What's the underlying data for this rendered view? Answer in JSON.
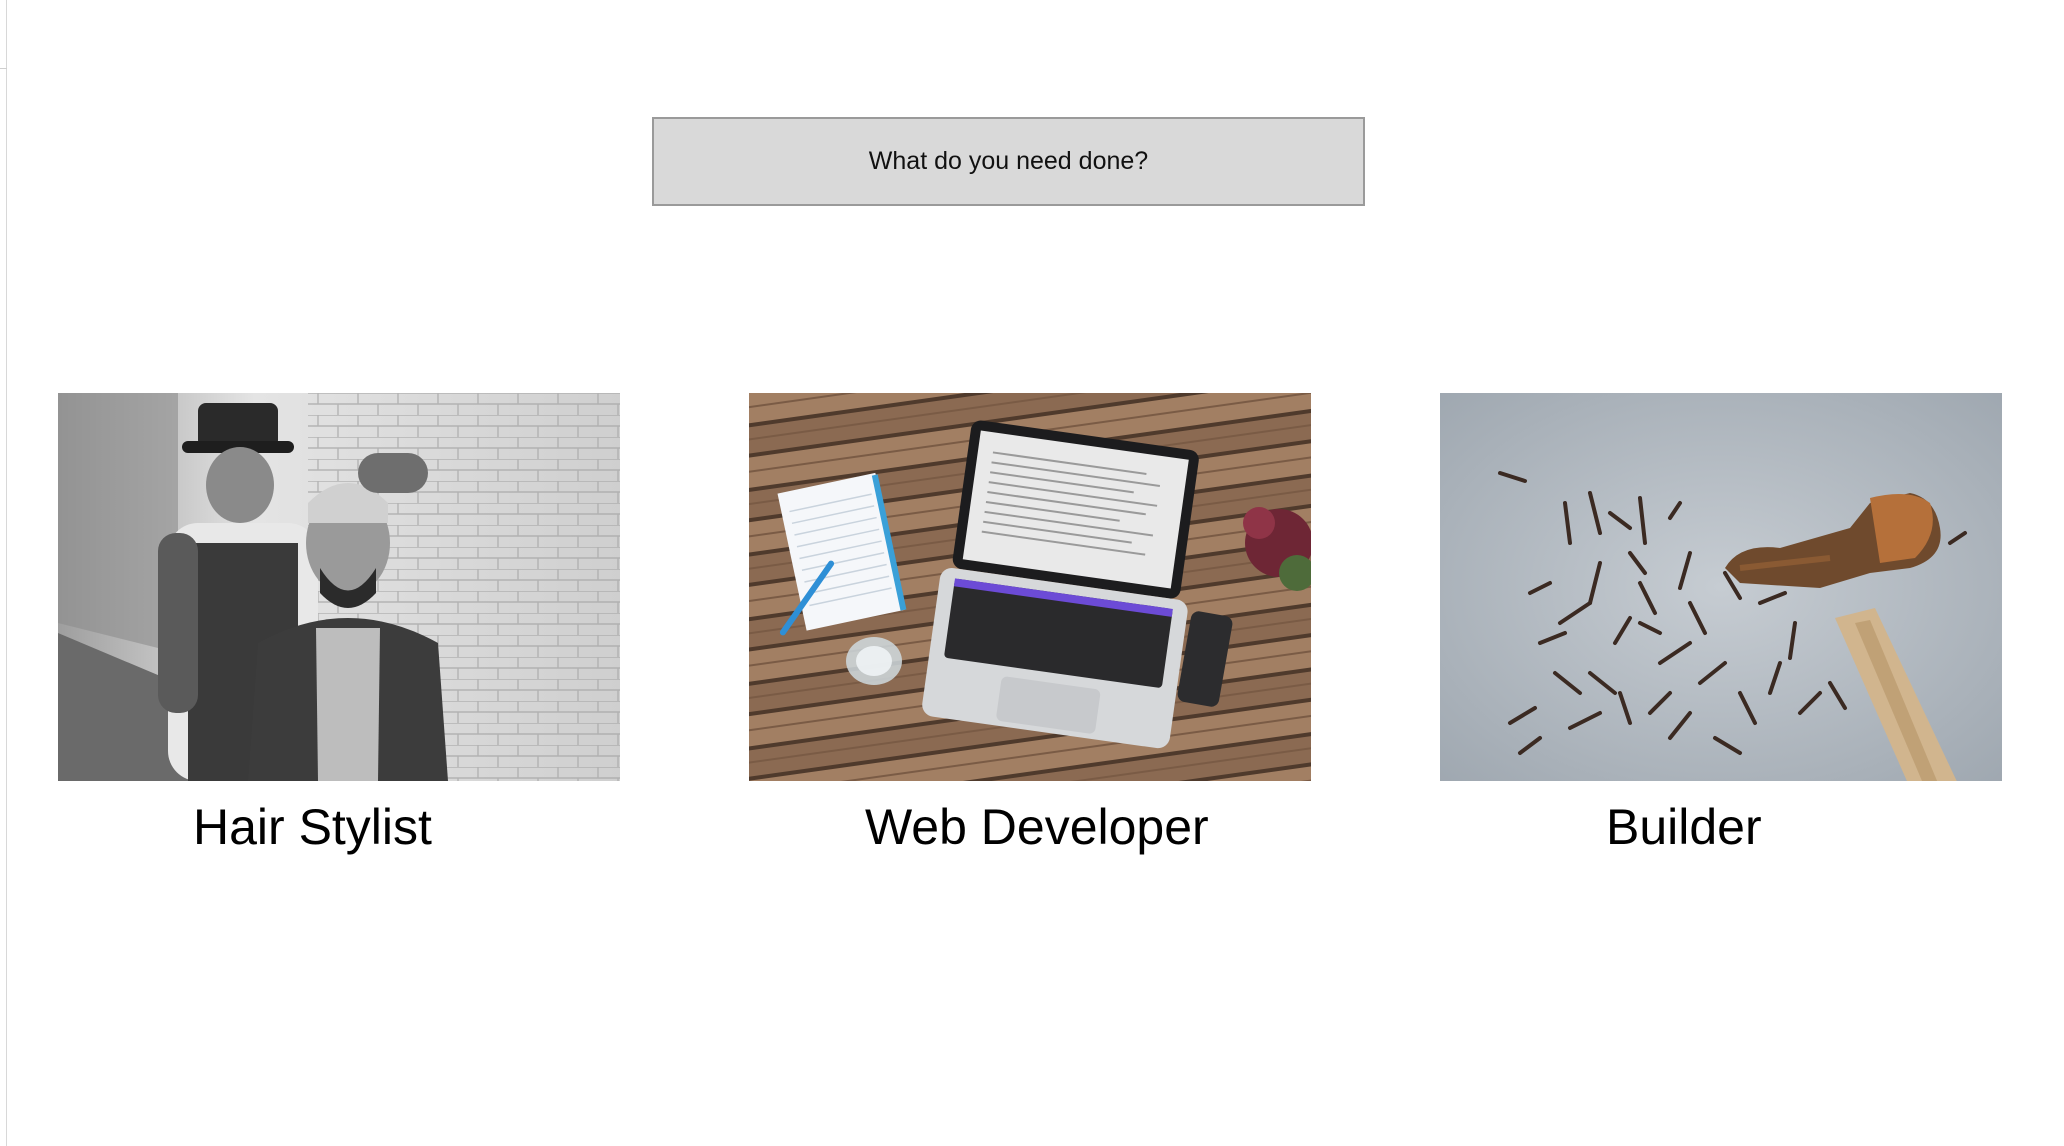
{
  "search": {
    "label": "What do you need done?"
  },
  "services": [
    {
      "label": "Hair Stylist",
      "image": "barber-photo"
    },
    {
      "label": "Web Developer",
      "image": "laptop-desk-photo"
    },
    {
      "label": "Builder",
      "image": "hammer-nails-photo"
    }
  ]
}
